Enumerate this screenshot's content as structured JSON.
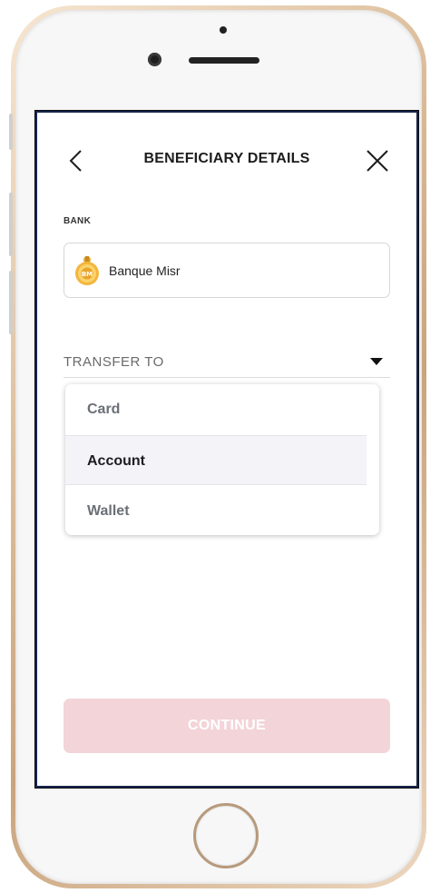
{
  "header": {
    "title": "BENEFICIARY DETAILS",
    "back_icon": "chevron-left-icon",
    "close_icon": "close-icon"
  },
  "bank": {
    "label": "BANK",
    "name": "Banque Misr",
    "logo_icon": "banque-misr-logo"
  },
  "transfer": {
    "label": "TRANSFER TO",
    "dropdown_icon": "caret-down-icon",
    "options": [
      {
        "label": "Card",
        "selected": false
      },
      {
        "label": "Account",
        "selected": true
      },
      {
        "label": "Wallet",
        "selected": false
      }
    ]
  },
  "footer": {
    "continue_label": "CONTINUE",
    "continue_bg": "#f3d4d8"
  }
}
